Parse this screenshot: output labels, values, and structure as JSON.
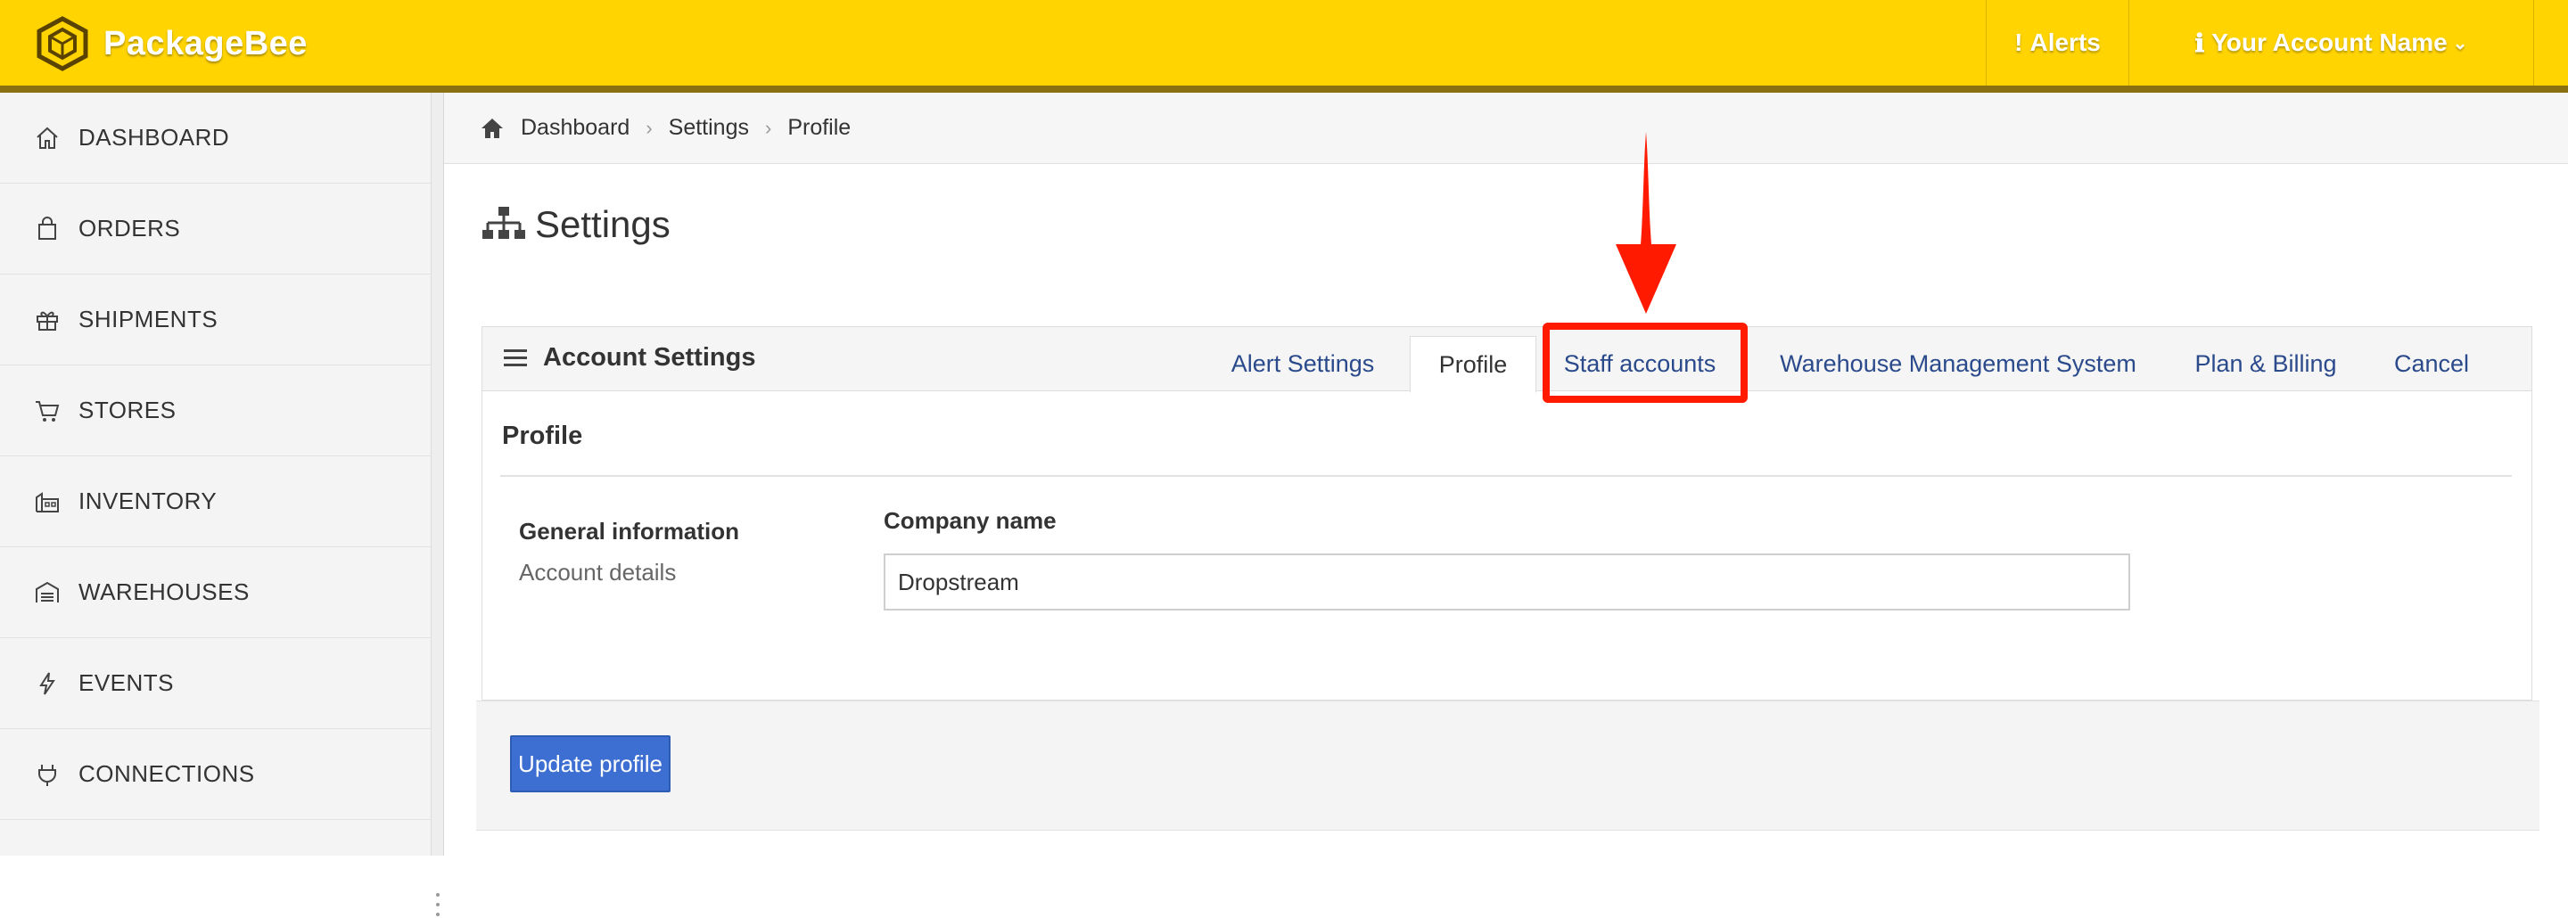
{
  "app": {
    "name": "PackageBee",
    "logo_icon": "hexagon-box-logo"
  },
  "topnav": {
    "alerts_label": "Alerts",
    "account_label": "Your Account Name",
    "alerts_icon": "exclamation-icon",
    "account_icon": "user-info-icon"
  },
  "sidebar": {
    "items": [
      {
        "label": "DASHBOARD",
        "icon": "home-icon"
      },
      {
        "label": "ORDERS",
        "icon": "shopping-bag-icon"
      },
      {
        "label": "SHIPMENTS",
        "icon": "gift-box-icon"
      },
      {
        "label": "STORES",
        "icon": "cart-icon"
      },
      {
        "label": "INVENTORY",
        "icon": "building-icon"
      },
      {
        "label": "WAREHOUSES",
        "icon": "warehouse-icon"
      },
      {
        "label": "EVENTS",
        "icon": "lightning-icon"
      },
      {
        "label": "CONNECTIONS",
        "icon": "plug-icon"
      }
    ]
  },
  "breadcrumb": {
    "items": [
      "Dashboard",
      "Settings",
      "Profile"
    ]
  },
  "page": {
    "title": "Settings"
  },
  "panel": {
    "title": "Account Settings",
    "tabs": [
      {
        "label": "Alert Settings"
      },
      {
        "label": "Profile",
        "active": true
      },
      {
        "label": "Staff accounts",
        "highlighted": true
      },
      {
        "label": "Warehouse Management System"
      },
      {
        "label": "Plan & Billing"
      },
      {
        "label": "Cancel"
      }
    ],
    "section_heading": "Profile",
    "info_title": "General information",
    "info_subtitle": "Account details",
    "company_label": "Company name",
    "company_value": "Dropstream"
  },
  "footer": {
    "update_label": "Update profile"
  },
  "colors": {
    "topbar": "#ffd400",
    "link": "#2a4a8c",
    "primary_button": "#3c6fd1",
    "highlight": "#ff1a00"
  }
}
